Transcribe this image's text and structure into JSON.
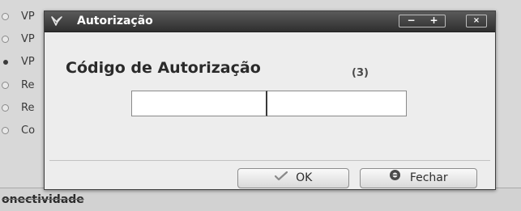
{
  "background": {
    "list_items": [
      {
        "label": "VP",
        "selected": false
      },
      {
        "label": "VP",
        "selected": false
      },
      {
        "label": "VP",
        "selected": true
      },
      {
        "label": "Re",
        "selected": false
      },
      {
        "label": "Re",
        "selected": false
      },
      {
        "label": "Co",
        "selected": false
      }
    ],
    "bottom_label": "onectividade"
  },
  "dialog": {
    "title": "Autorização",
    "window_buttons": {
      "minimize": "−",
      "maximize": "+",
      "close": "×"
    },
    "heading": "Código de Autorização",
    "attempts_counter": "(3)",
    "code_field_1": {
      "value": "",
      "placeholder": ""
    },
    "code_field_2": {
      "value": "",
      "placeholder": ""
    },
    "ok_button": {
      "label": "OK",
      "icon": "check-icon"
    },
    "close_button": {
      "label": "Fechar",
      "icon": "close-circle-icon"
    }
  },
  "colors": {
    "titlebar": "#3a3a3a",
    "dialog_bg": "#ededed"
  }
}
